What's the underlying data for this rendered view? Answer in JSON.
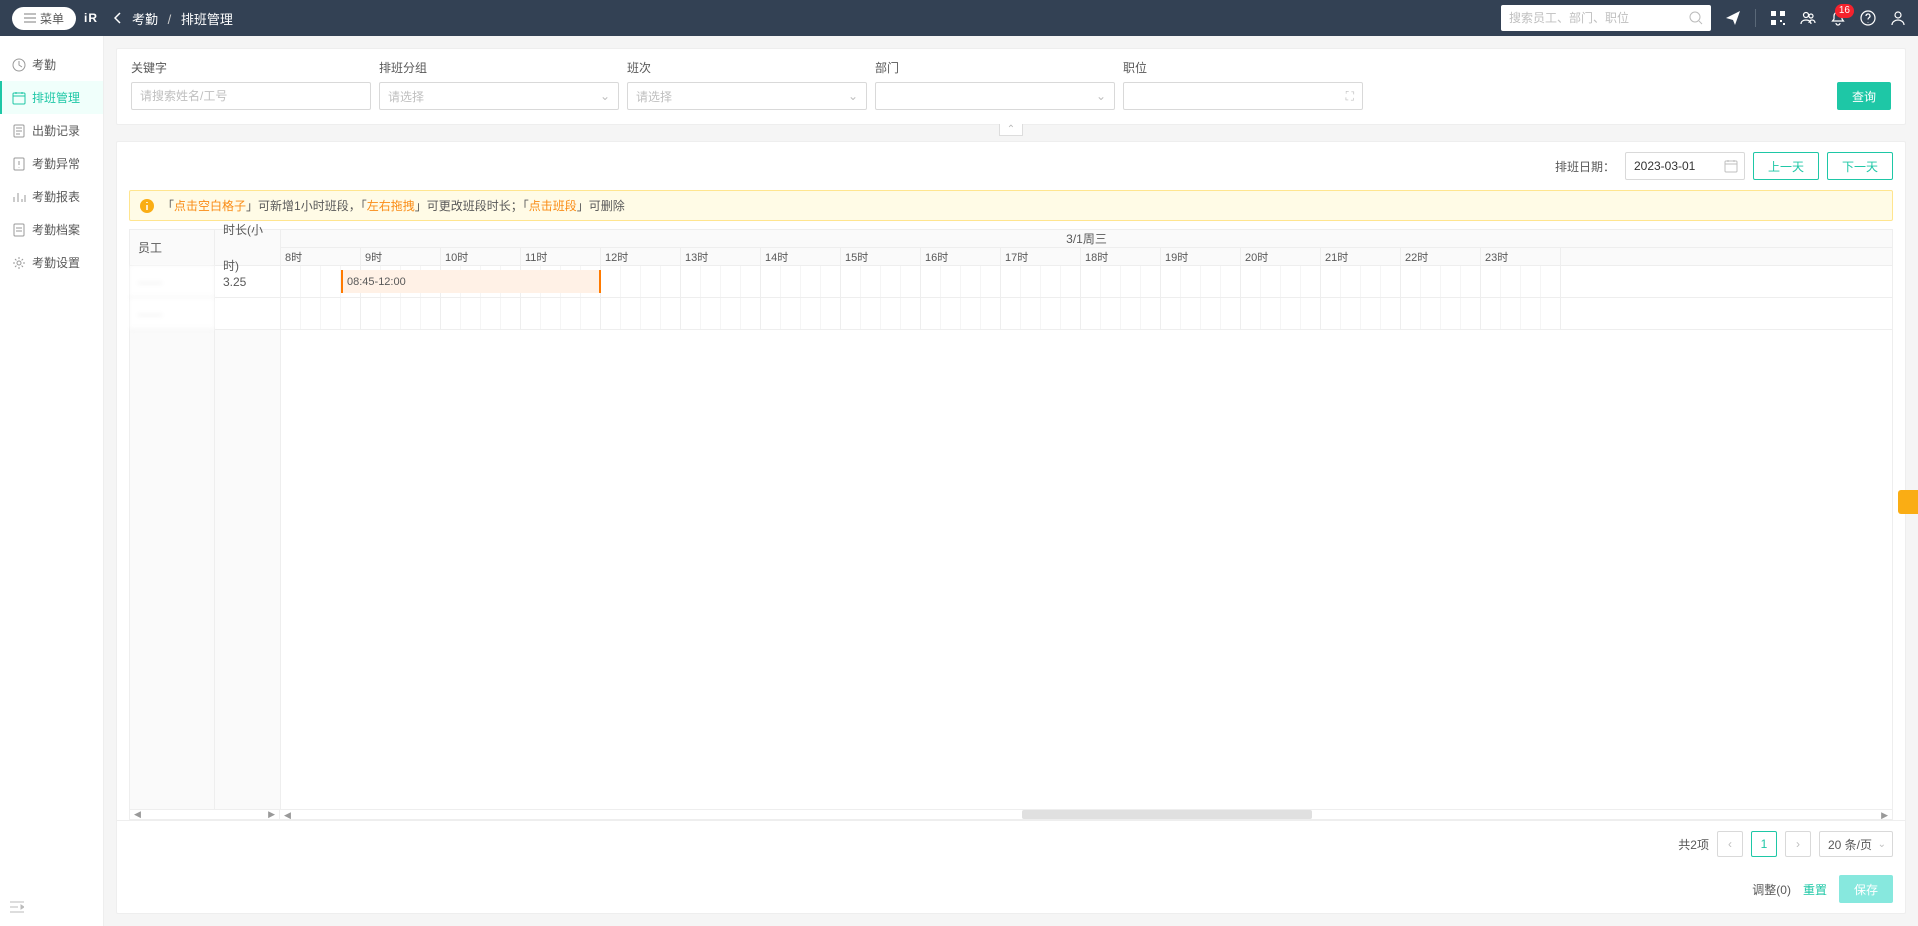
{
  "header": {
    "menu_label": "菜单",
    "logo_text": "iR",
    "breadcrumb": {
      "parent": "考勤",
      "current": "排班管理"
    },
    "search_placeholder": "搜索员工、部门、职位",
    "notification_count": "16"
  },
  "sidebar": {
    "items": [
      {
        "label": "考勤"
      },
      {
        "label": "排班管理"
      },
      {
        "label": "出勤记录"
      },
      {
        "label": "考勤异常"
      },
      {
        "label": "考勤报表"
      },
      {
        "label": "考勤档案"
      },
      {
        "label": "考勤设置"
      }
    ]
  },
  "filters": {
    "keyword_label": "关键字",
    "keyword_placeholder": "请搜索姓名/工号",
    "group_label": "排班分组",
    "group_placeholder": "请选择",
    "shift_label": "班次",
    "shift_placeholder": "请选择",
    "dept_label": "部门",
    "dept_placeholder": "",
    "position_label": "职位",
    "position_placeholder": "",
    "search_btn": "查询"
  },
  "toolbar": {
    "date_label": "排班日期：",
    "date_value": "2023-03-01",
    "prev_day": "上一天",
    "next_day": "下一天"
  },
  "tip": {
    "parts": [
      "「",
      "点击空白格子",
      "」可新增1小时班段，「",
      "左右拖拽",
      "」可更改班段时长；「",
      "点击班段",
      "」可删除"
    ]
  },
  "schedule": {
    "emp_header": "员工",
    "dur_header": "时长(小时)",
    "day_header": "3/1周三",
    "hours": [
      "8时",
      "9时",
      "10时",
      "11时",
      "12时",
      "13时",
      "14时",
      "15时",
      "16时",
      "17时",
      "18时",
      "19时",
      "20时",
      "21时",
      "22时",
      "23时"
    ],
    "rows": [
      {
        "emp": "——",
        "duration": "3.25",
        "shift_label": "08:45-12:00",
        "shift_start_q": 3,
        "shift_span_q": 13
      },
      {
        "emp": "——",
        "duration": ""
      }
    ]
  },
  "pager": {
    "total_text": "共2项",
    "current": "1",
    "pagesize": "20 条/页"
  },
  "actions": {
    "adjust_label": "调整(0)",
    "reset_label": "重置",
    "save_label": "保存"
  }
}
